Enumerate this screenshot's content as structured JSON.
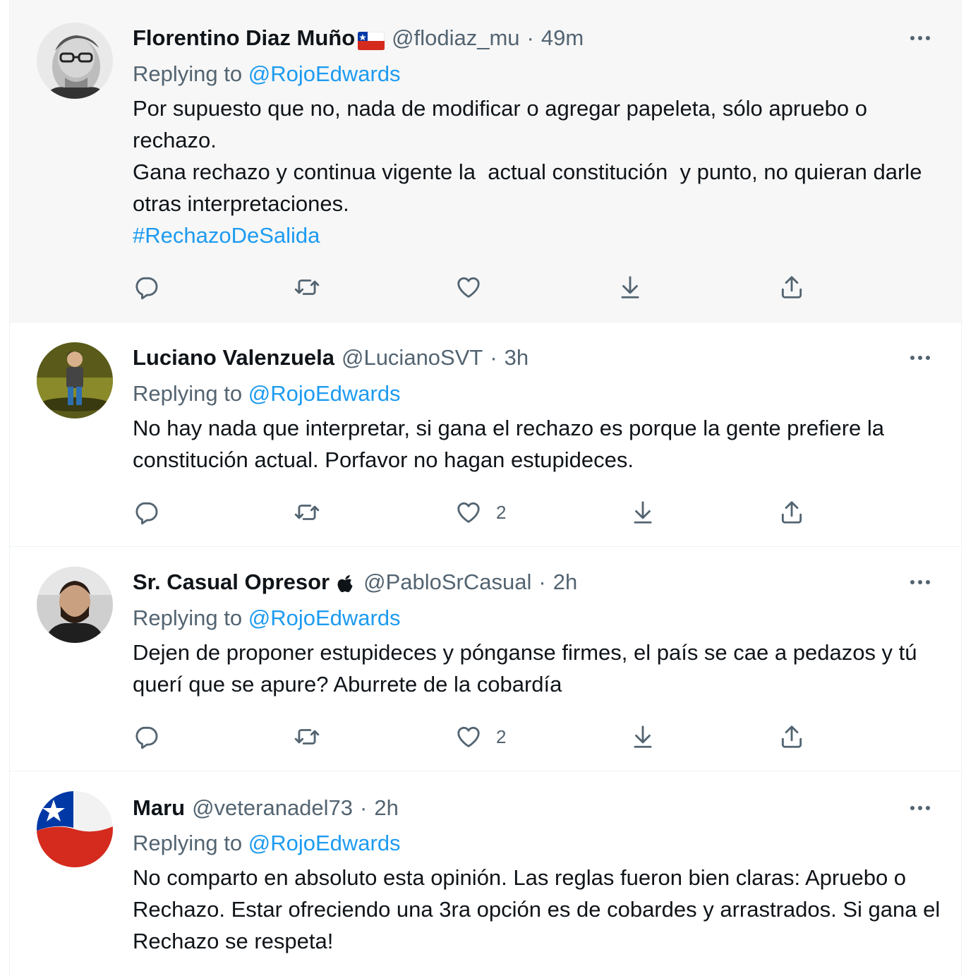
{
  "tweets": [
    {
      "name": "Florentino Diaz Muño",
      "has_flag": true,
      "handle": "@flodiaz_mu",
      "separator": "·",
      "time": "49m",
      "replying_prefix": "Replying to",
      "replying_to": "@RojoEdwards",
      "lines": [
        "Por supuesto que no, nada de modificar o agregar papeleta, sólo apruebo o rechazo.",
        "Gana rechazo y continua vigente la  actual constitución  y punto, no quieran darle otras interpretaciones."
      ],
      "hashtag": "#RechazoDeSalida",
      "likes": "",
      "avatar_icon": "avatar-elderly-man-glasses"
    },
    {
      "name": "Luciano Valenzuela",
      "handle": "@LucianoSVT",
      "separator": "·",
      "time": "3h",
      "replying_prefix": "Replying to",
      "replying_to": "@RojoEdwards",
      "lines": [
        "No hay nada que interpretar, si gana el rechazo es porque la gente prefiere la constitución actual. Porfavor no hagan estupideces."
      ],
      "likes": "2",
      "avatar_icon": "avatar-cartoon-man"
    },
    {
      "name": "Sr. Casual Opresor",
      "has_apple": true,
      "handle": "@PabloSrCasual",
      "separator": "·",
      "time": "2h",
      "replying_prefix": "Replying to",
      "replying_to": "@RojoEdwards",
      "lines": [
        "Dejen de proponer estupideces y pónganse firmes, el país se cae a pedazos y tú querí que se apure? Aburrete de la cobardía"
      ],
      "likes": "2",
      "avatar_icon": "avatar-young-man-beard"
    },
    {
      "name": "Maru",
      "handle": "@veteranadel73",
      "separator": "·",
      "time": "2h",
      "replying_prefix": "Replying to",
      "replying_to": "@RojoEdwards",
      "lines": [
        "No comparto en absoluto esta opinión. Las reglas fueron bien claras: Apruebo o Rechazo. Estar ofreciendo una 3ra opción es de cobardes y arrastrados. Si gana el Rechazo se respeta!"
      ],
      "avatar_icon": "avatar-chile-flag"
    }
  ],
  "colors": {
    "text": "#0f1419",
    "secondary": "#536471",
    "link": "#1d9bf0",
    "hover_bg": "#f7f7f7",
    "border": "#eff3f4"
  },
  "action_icons": [
    "reply-icon",
    "retweet-icon",
    "like-icon",
    "download-icon",
    "share-icon"
  ]
}
